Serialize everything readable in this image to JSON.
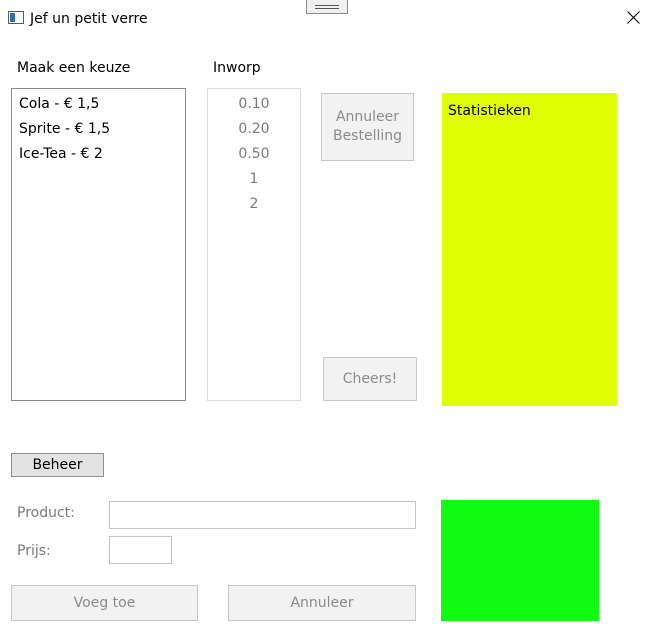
{
  "window": {
    "title": "Jef un petit verre",
    "close_symbol": "close-icon"
  },
  "labels": {
    "choose": "Maak een keuze",
    "coins": "Inworp"
  },
  "products": [
    "Cola - € 1,5",
    "Sprite - € 1,5",
    "Ice-Tea - € 2"
  ],
  "coins": [
    "0.10",
    "0.20",
    "0.50",
    "1",
    "2"
  ],
  "buttons": {
    "cancel_order_line1": "Annuleer",
    "cancel_order_line2": "Bestelling",
    "cheers": "Cheers!",
    "manage": "Beheer",
    "add": "Voeg toe",
    "cancel": "Annuleer"
  },
  "stats": {
    "title": "Statistieken",
    "color": "#E0FF00"
  },
  "form": {
    "product_label": "Product:",
    "price_label": "Prijs:",
    "product_value": "",
    "price_value": ""
  },
  "colors": {
    "stats_panel": "#E0FF00",
    "green_panel": "#11FA11",
    "disabled_text": "#8A8A8A"
  }
}
